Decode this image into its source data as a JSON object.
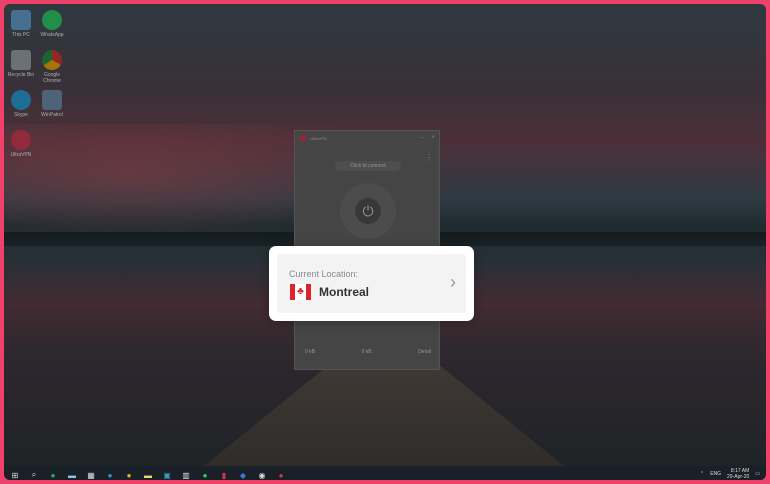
{
  "desktop": {
    "icons": [
      {
        "label": "This PC",
        "icon": "computer-icon",
        "color": "#5fa0d8"
      },
      {
        "label": "WhatsApp",
        "icon": "whatsapp-icon",
        "color": "#25d366"
      },
      {
        "label": "Recycle Bin",
        "icon": "recycle-bin-icon",
        "color": "#9aa5ad"
      },
      {
        "label": "Google Chrome",
        "icon": "chrome-icon",
        "color": "#e9b62b"
      },
      {
        "label": "Skype",
        "icon": "skype-icon",
        "color": "#1d9fe0"
      },
      {
        "label": "WinPatrol",
        "icon": "winpatrol-icon",
        "color": "#6c8fb0"
      },
      {
        "label": "UltraVPN",
        "icon": "ultravpn-icon",
        "color": "#d8344f"
      }
    ]
  },
  "vpn_window": {
    "title": "UltraVPN",
    "connect_label": "Click to connect",
    "stats": [
      "0 kB",
      "0 kB",
      "Detail"
    ]
  },
  "location_card": {
    "label": "Current Location:",
    "city": "Montreal",
    "flag": "canada-flag-icon",
    "chevron": "›"
  },
  "taskbar": {
    "items": [
      "windows-start-icon",
      "search-icon",
      "spotify-icon",
      "file-explorer-icon",
      "calculator-icon",
      "skype-icon",
      "chrome-icon",
      "sticky-notes-icon",
      "terminal-icon",
      "app-icon",
      "whatsapp-icon",
      "app-icon",
      "edge-icon",
      "app-icon",
      "ultravpn-icon"
    ],
    "clock_time": "8:17 AM",
    "clock_date": "29-Apr-20",
    "lang": "ENG"
  },
  "colors": {
    "frame_border": "#f0416b",
    "card_bg": "#ffffff",
    "flag_red": "#e0242b"
  }
}
